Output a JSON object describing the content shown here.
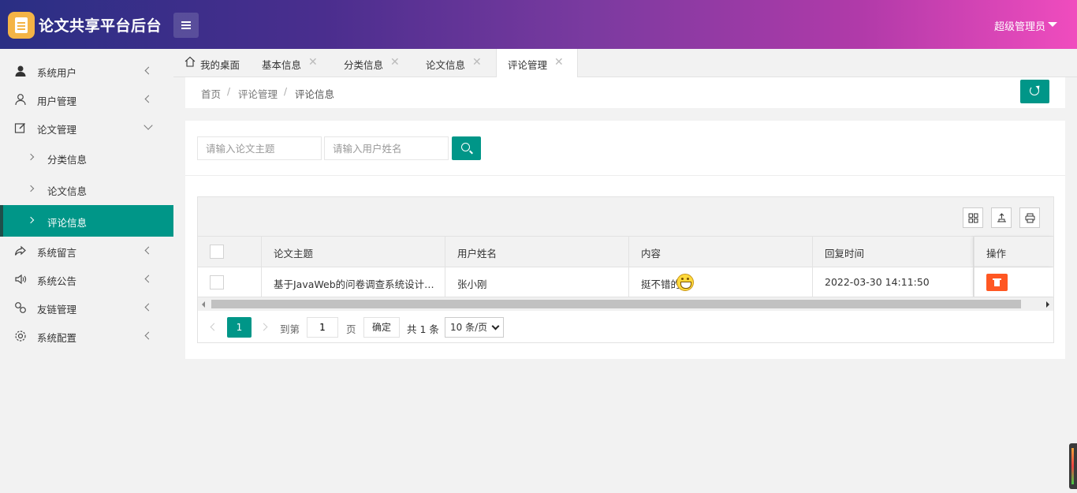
{
  "app": {
    "title": "论文共享平台后台",
    "user": "超级管理员"
  },
  "sidebar": {
    "items": [
      {
        "label": "系统用户",
        "icon": "user-filled-icon"
      },
      {
        "label": "用户管理",
        "icon": "user-outline-icon"
      },
      {
        "label": "论文管理",
        "icon": "edit-icon"
      },
      {
        "label": "系统留言",
        "icon": "share-icon"
      },
      {
        "label": "系统公告",
        "icon": "speaker-icon"
      },
      {
        "label": "友链管理",
        "icon": "link-icon"
      },
      {
        "label": "系统配置",
        "icon": "gear-icon"
      }
    ],
    "subitems": [
      {
        "label": "分类信息"
      },
      {
        "label": "论文信息"
      },
      {
        "label": "评论信息",
        "active": true
      }
    ]
  },
  "tabs": [
    {
      "label": "我的桌面"
    },
    {
      "label": "基本信息"
    },
    {
      "label": "分类信息"
    },
    {
      "label": "论文信息"
    },
    {
      "label": "评论管理",
      "active": true
    }
  ],
  "breadcrumb": {
    "items": [
      "首页",
      "评论管理",
      "评论信息"
    ],
    "separator": "/"
  },
  "search": {
    "topic_placeholder": "请输入论文主题",
    "user_placeholder": "请输入用户姓名"
  },
  "table": {
    "columns": [
      "论文主题",
      "用户姓名",
      "内容",
      "回复时间",
      "操作"
    ],
    "rows": [
      {
        "topic": "基于JavaWeb的问卷调查系统设计…",
        "user": "张小刚",
        "content": "挺不错的。",
        "time": "2022-03-30 14:11:50"
      }
    ]
  },
  "pagination": {
    "current": "1",
    "goto_label": "到第",
    "goto_value": "1",
    "page_unit": "页",
    "confirm": "确定",
    "total": "共 1 条",
    "page_size": "10 条/页"
  },
  "colors": {
    "accent": "#009688",
    "danger": "#ff5722"
  }
}
